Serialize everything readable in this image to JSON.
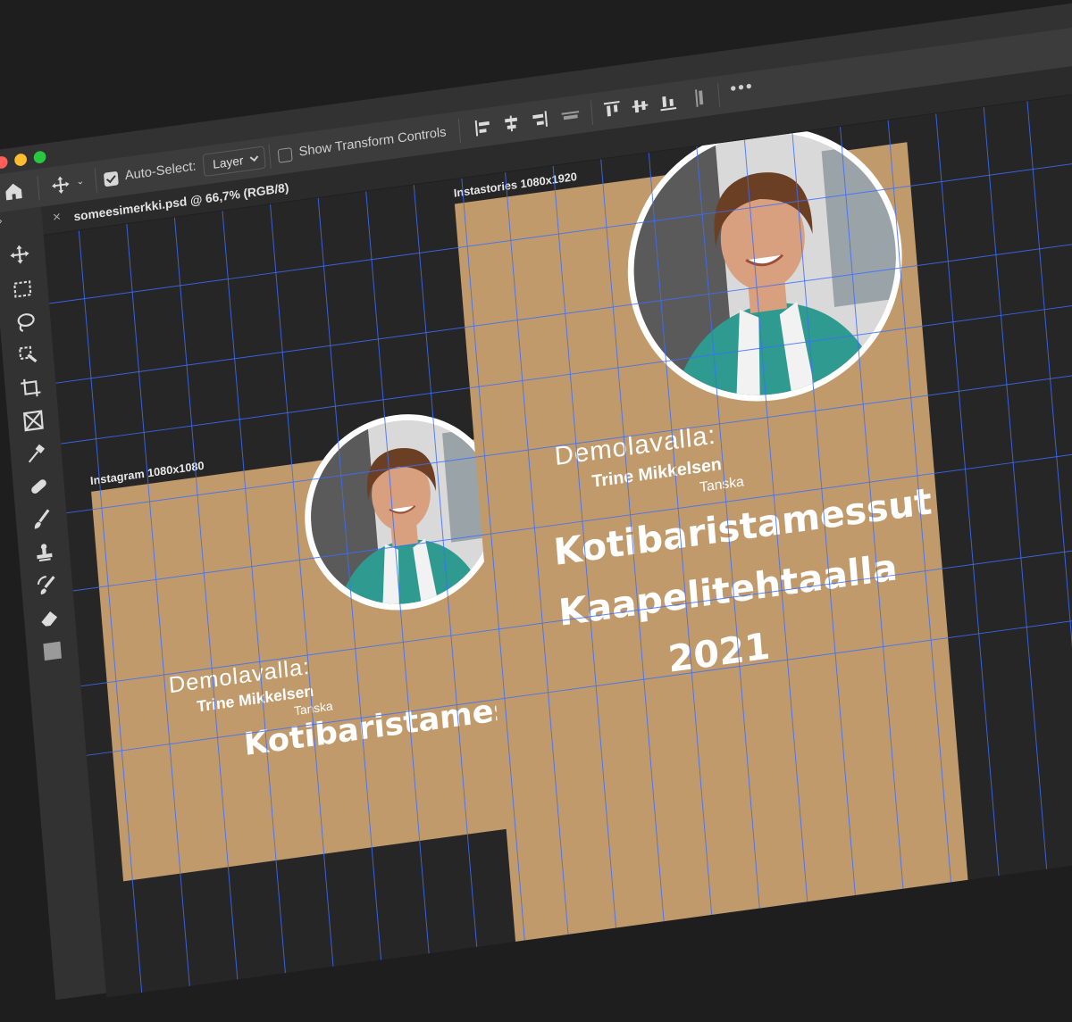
{
  "toolbar": {
    "auto_select_label": "Auto-Select:",
    "layer_select_value": "Layer",
    "show_transform_label": "Show Transform Controls"
  },
  "document": {
    "tab_title": "someesimerkki.psd @ 66,7% (RGB/8)"
  },
  "artboards": {
    "instagram": {
      "label": "Instagram 1080x1080",
      "demo": "Demolavalla:",
      "speaker": "Trine Mikkelsen",
      "country": "Tanska",
      "title": "Kotibaristamessut"
    },
    "stories": {
      "label": "Instastories 1080x1920",
      "demo": "Demolavalla:",
      "speaker": "Trine Mikkelsen",
      "country": "Tanska",
      "title_line1": "Kotibaristamessut",
      "title_line2": "Kaapelitehtaalla",
      "title_line3": "2021"
    }
  },
  "colors": {
    "artboard_bg": "#c09a6b",
    "guide": "#3b6fff",
    "canvas_bg": "#262626",
    "panel_bg": "#323232"
  },
  "icons": [
    "home-icon",
    "move-icon",
    "marquee-icon",
    "lasso-icon",
    "quick-select-icon",
    "crop-icon",
    "frame-icon",
    "eyedropper-icon",
    "healing-icon",
    "brush-icon",
    "stamp-icon",
    "history-brush-icon",
    "eraser-icon",
    "align-icons",
    "more-icon"
  ]
}
